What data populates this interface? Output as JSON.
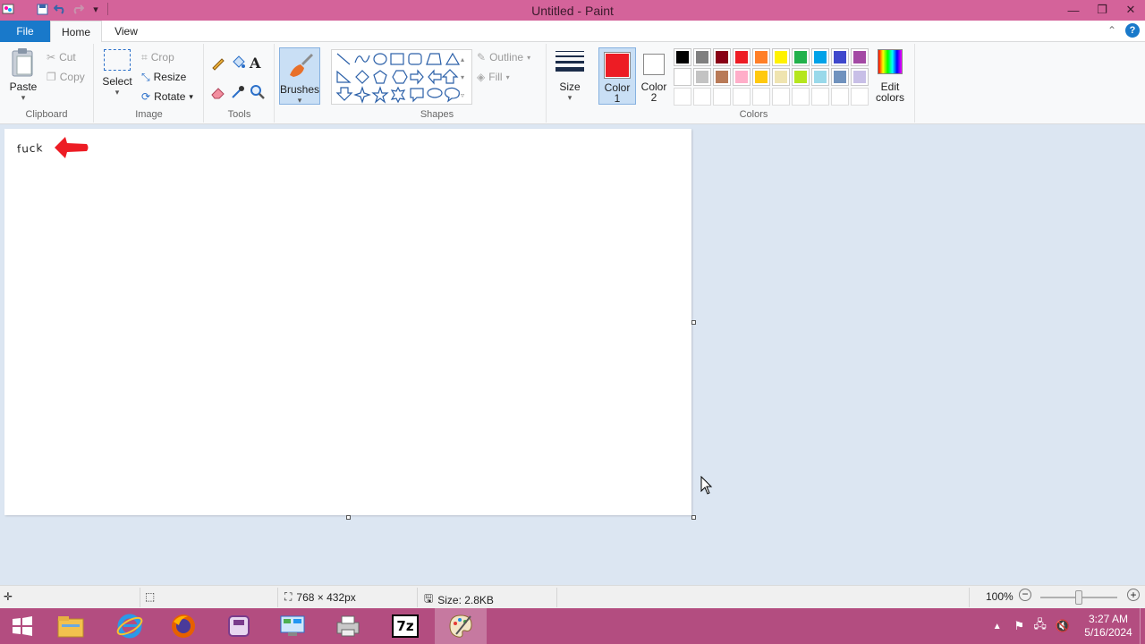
{
  "window": {
    "title": "Untitled - Paint"
  },
  "tabs": {
    "file": "File",
    "home": "Home",
    "view": "View"
  },
  "clipboard": {
    "paste": "Paste",
    "cut": "Cut",
    "copy": "Copy",
    "label": "Clipboard"
  },
  "image": {
    "select": "Select",
    "crop": "Crop",
    "resize": "Resize",
    "rotate": "Rotate",
    "label": "Image"
  },
  "tools": {
    "label": "Tools"
  },
  "brushes": {
    "label": "Brushes"
  },
  "shapes": {
    "label": "Shapes",
    "outline": "Outline",
    "fill": "Fill"
  },
  "size": {
    "label": "Size"
  },
  "colors": {
    "label": "Colors",
    "color1_label": "Color 1",
    "color2_label": "Color 2",
    "color1": "#ed1c24",
    "color2": "#ffffff",
    "edit_colors": "Edit colors",
    "palette_row1": [
      "#000000",
      "#7f7f7f",
      "#880015",
      "#ed1c24",
      "#ff7f27",
      "#fff200",
      "#22b14c",
      "#00a2e8",
      "#3f48cc",
      "#a349a4"
    ],
    "palette_row2": [
      "#ffffff",
      "#c3c3c3",
      "#b97a57",
      "#ffaec9",
      "#ffc90e",
      "#efe4b0",
      "#b5e61d",
      "#99d9ea",
      "#7092be",
      "#c8bfe7"
    ],
    "palette_row3": [
      "#ffffff",
      "#ffffff",
      "#ffffff",
      "#ffffff",
      "#ffffff",
      "#ffffff",
      "#ffffff",
      "#ffffff",
      "#ffffff",
      "#ffffff"
    ]
  },
  "canvas": {
    "drawn_text": "fuck",
    "arrow_color": "#ed1c24"
  },
  "status": {
    "dimensions": "768 × 432px",
    "size": "Size: 2.8KB",
    "zoom": "100%"
  },
  "clock": {
    "time": "3:27 AM",
    "date": "5/16/2024"
  }
}
